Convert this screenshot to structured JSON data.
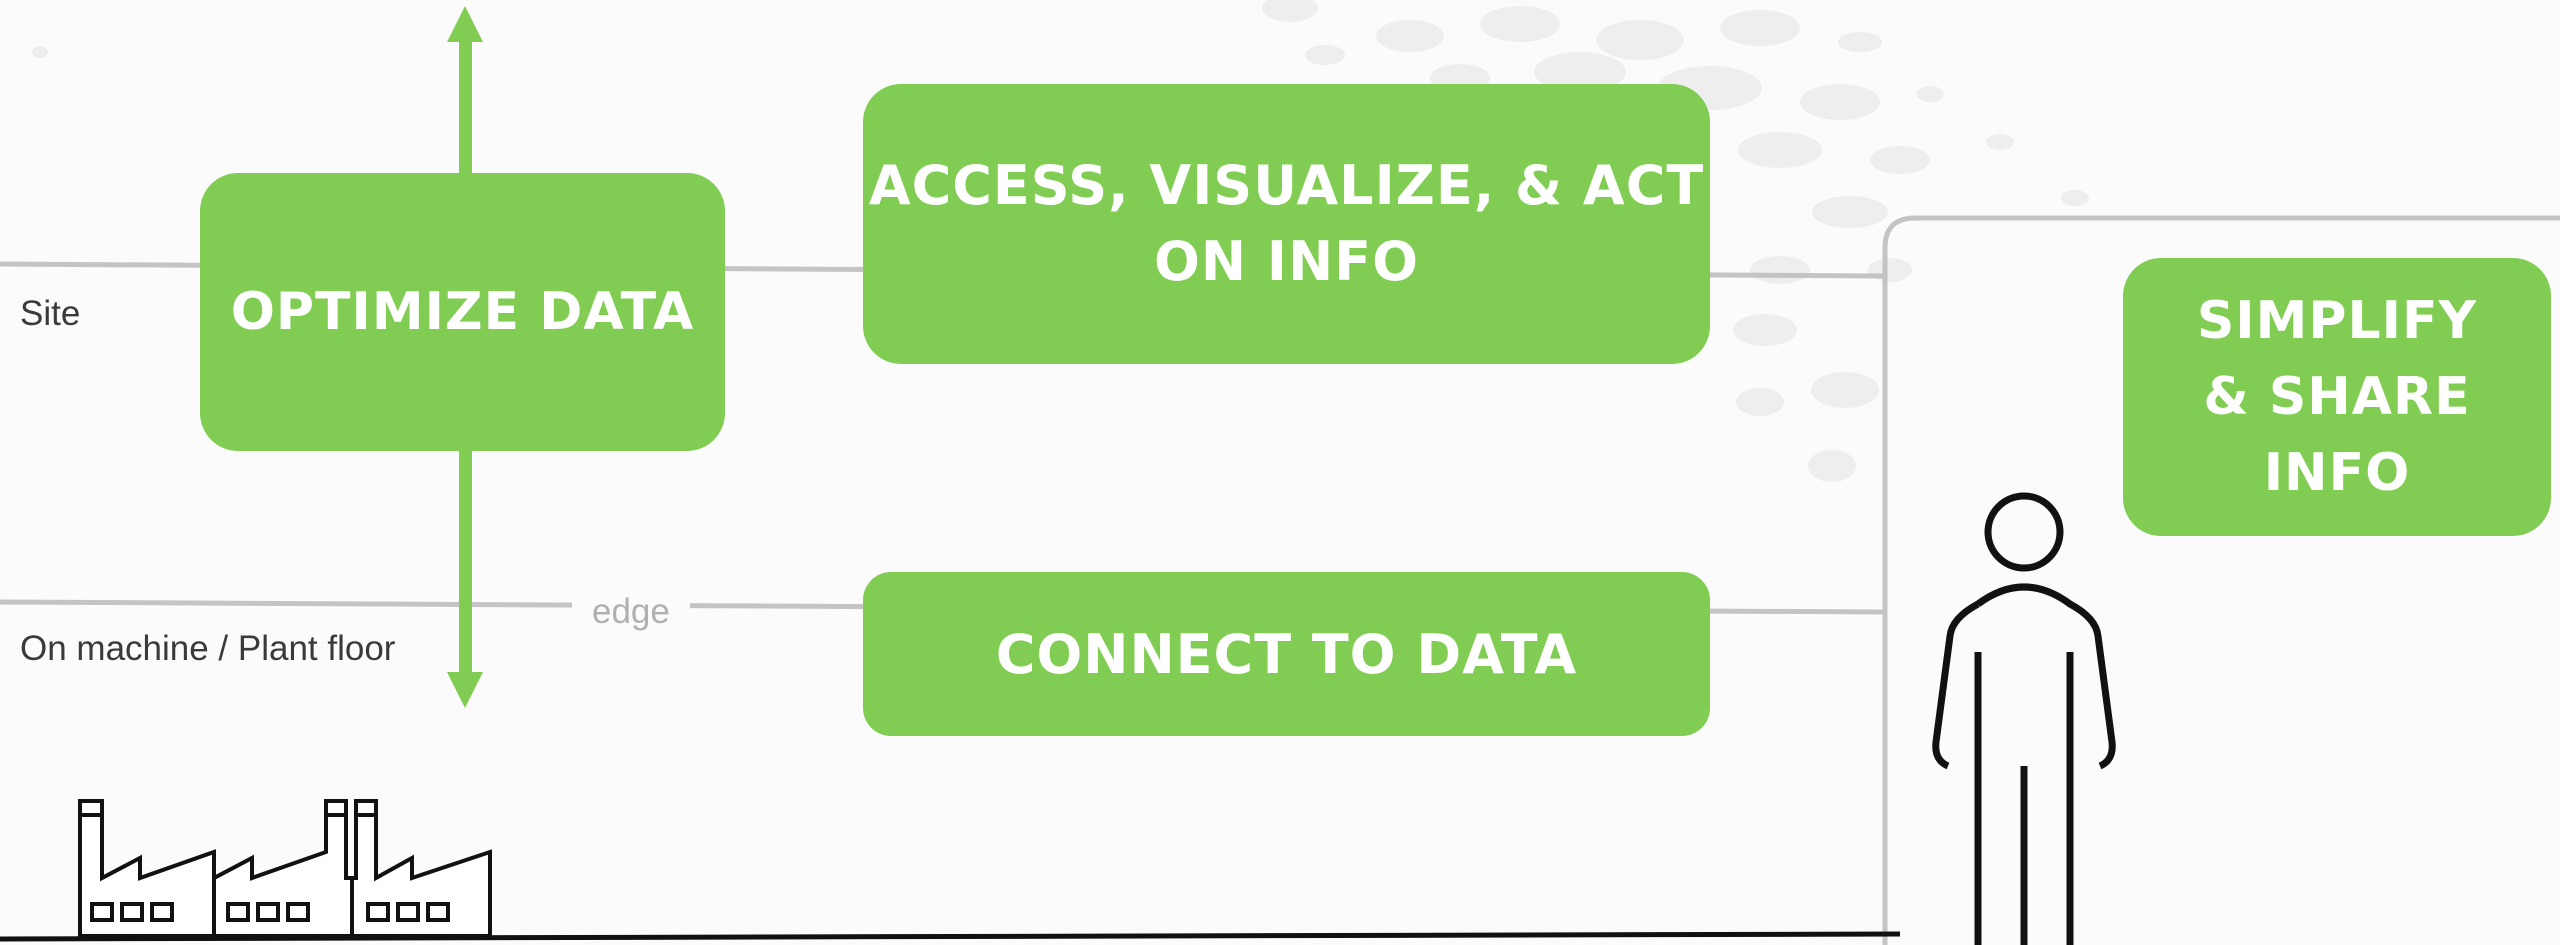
{
  "colors": {
    "accent_green": "#81cd53",
    "line_gray": "#c4c4c4",
    "text_dark": "#3a3a3a",
    "edge_text": "#b0b0b0"
  },
  "levels": {
    "site": "Site",
    "plant": "On machine / Plant floor",
    "edge": "edge"
  },
  "boxes": {
    "optimize": "OPTIMIZE DATA",
    "access_line1": "ACCESS, VISUALIZE, & ACT",
    "access_line2": "ON INFO",
    "connect": "CONNECT TO DATA",
    "simplify_line1": "SIMPLIFY",
    "simplify_line2": "& SHARE",
    "simplify_line3": "INFO"
  },
  "icons": [
    "factory-icon",
    "person-icon",
    "double-arrow-icon"
  ]
}
